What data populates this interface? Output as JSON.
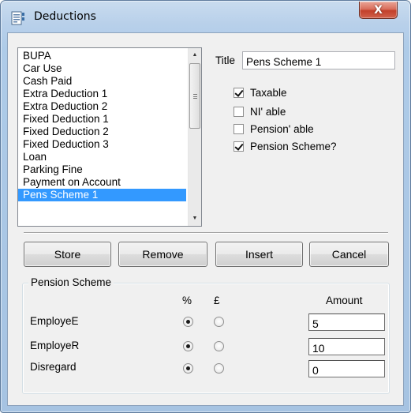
{
  "window": {
    "title": "Deductions",
    "close_glyph": "X"
  },
  "deductions_list": {
    "items": [
      "BUPA",
      "Car Use",
      "Cash Paid",
      "Extra Deduction 1",
      "Extra Deduction 2",
      "Fixed Deduction 1",
      "Fixed Deduction 2",
      "Fixed Deduction 3",
      "Loan",
      "Parking Fine",
      "Payment on Account",
      "Pens Scheme 1"
    ],
    "selected_item": "Pens Scheme 1"
  },
  "title_field": {
    "label": "Title",
    "value": "Pens Scheme 1"
  },
  "options": {
    "taxable": {
      "label": "Taxable",
      "checked": true
    },
    "ni_able": {
      "label": "NI' able",
      "checked": false
    },
    "pension_able": {
      "label": "Pension' able",
      "checked": false
    },
    "pension_scheme": {
      "label": "Pension Scheme?",
      "checked": true
    }
  },
  "buttons": {
    "store": "Store",
    "remove": "Remove",
    "insert": "Insert",
    "cancel": "Cancel"
  },
  "pension_scheme": {
    "group_label": "Pension Scheme",
    "col_percent": "%",
    "col_pound": "£",
    "col_amount": "Amount",
    "rows": [
      {
        "label": "EmployeE",
        "basis": "percent",
        "amount": "5"
      },
      {
        "label": "EmployeR",
        "basis": "percent",
        "amount": "10"
      },
      {
        "label": "Disregard",
        "basis": "percent",
        "amount": "0"
      }
    ]
  },
  "colors": {
    "selection": "#3399ff",
    "close_button": "#c2402b",
    "frame": "#b8d0ea"
  },
  "icons": {
    "app": "form-icon",
    "close": "close-icon"
  }
}
